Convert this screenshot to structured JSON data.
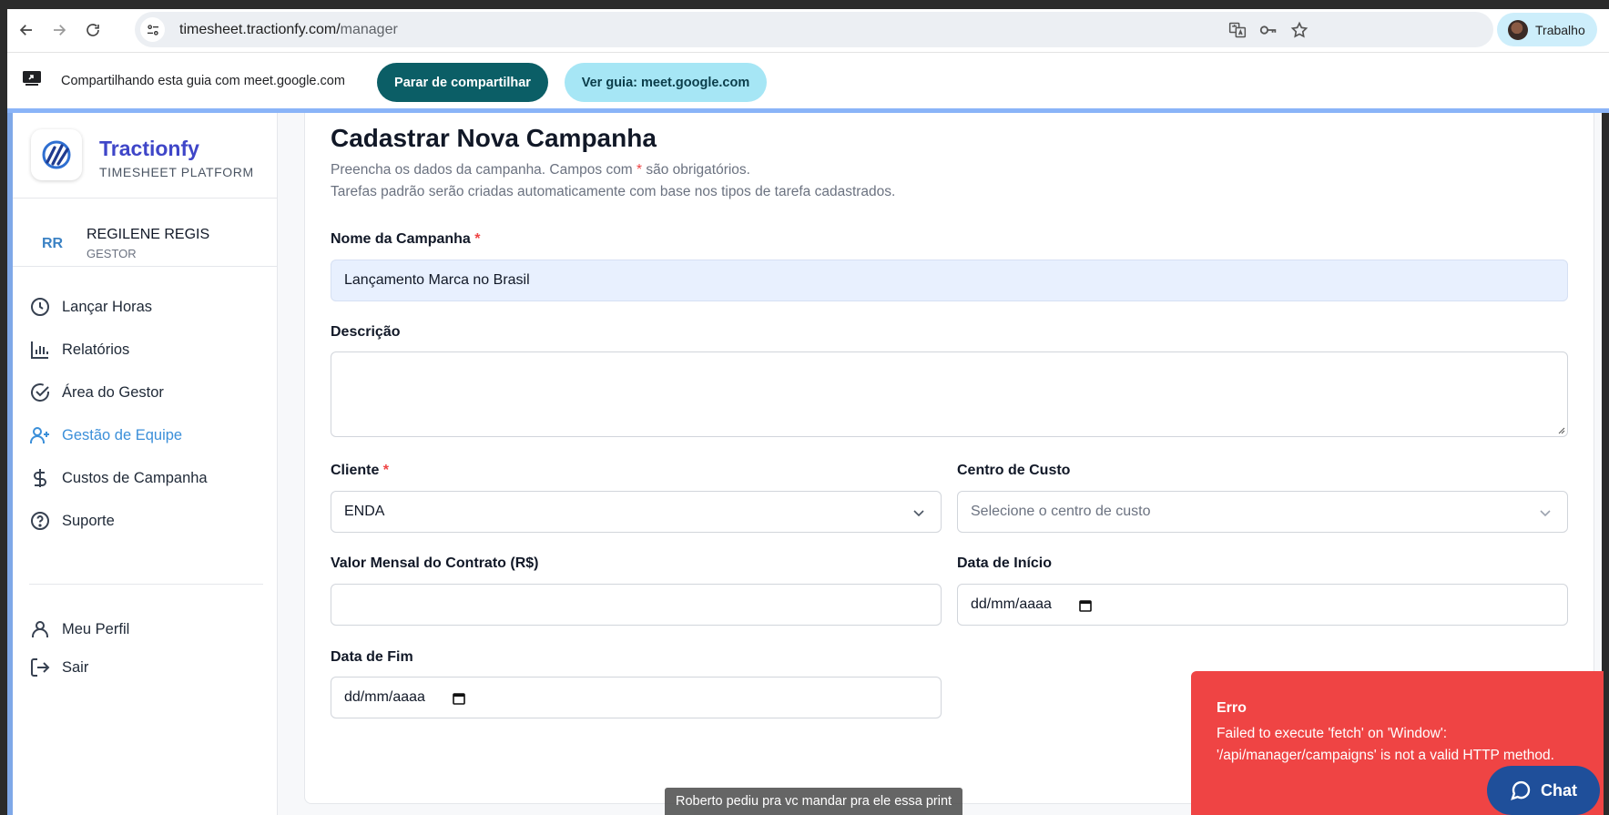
{
  "browser": {
    "url_host": "timesheet.tractionfy.com/",
    "url_path": "manager",
    "profile_name": "Trabalho"
  },
  "share_bar": {
    "text": "Compartilhando esta guia com meet.google.com",
    "stop_label": "Parar de compartilhar",
    "view_label": "Ver guia: meet.google.com"
  },
  "sidebar": {
    "brand": "Tractionfy",
    "brand_sub": "TIMESHEET PLATFORM",
    "user": {
      "initials": "RR",
      "name": "REGILENE REGIS",
      "role": "GESTOR"
    },
    "items": [
      {
        "label": "Lançar Horas",
        "icon": "clock-icon"
      },
      {
        "label": "Relatórios",
        "icon": "bar-chart-icon"
      },
      {
        "label": "Área do Gestor",
        "icon": "check-circle-icon"
      },
      {
        "label": "Gestão de Equipe",
        "icon": "user-plus-icon",
        "active": true
      },
      {
        "label": "Custos de Campanha",
        "icon": "dollar-icon"
      },
      {
        "label": "Suporte",
        "icon": "help-circle-icon"
      }
    ],
    "bottom_items": [
      {
        "label": "Meu Perfil",
        "icon": "user-icon"
      },
      {
        "label": "Sair",
        "icon": "logout-icon"
      }
    ]
  },
  "form": {
    "title": "Cadastrar Nova Campanha",
    "subtitle_part1": "Preencha os dados da campanha. Campos com ",
    "subtitle_star": "*",
    "subtitle_part2": " são obrigatórios.",
    "subtitle_line2": "Tarefas padrão serão criadas automaticamente com base nos tipos de tarefa cadastrados.",
    "name_label": "Nome da Campanha",
    "name_value": "Lançamento Marca no Brasil",
    "description_label": "Descrição",
    "description_value": "",
    "client_label": "Cliente",
    "client_value": "ENDA",
    "cost_center_label": "Centro de Custo",
    "cost_center_placeholder": "Selecione o centro de custo",
    "monthly_value_label": "Valor Mensal do Contrato (R$)",
    "monthly_value": "",
    "start_date_label": "Data de Início",
    "start_date_placeholder": "dd/mm/aaaa",
    "end_date_label": "Data de Fim",
    "end_date_placeholder": "dd/mm/aaaa",
    "required_mark": "*"
  },
  "toast": {
    "title": "Erro",
    "message": "Failed to execute 'fetch' on 'Window': '/api/manager/campaigns' is not a valid HTTP method."
  },
  "chat": {
    "label": "Chat"
  },
  "caption": "Roberto pediu pra vc mandar pra ele essa print",
  "colors": {
    "brand": "#3f46c8",
    "active_nav": "#3b8fd9",
    "error_toast": "#ef4444",
    "stop_share_button": "#0b5e66",
    "view_tab_button": "#a6e6f5",
    "chat_button": "#1f4f9a"
  }
}
